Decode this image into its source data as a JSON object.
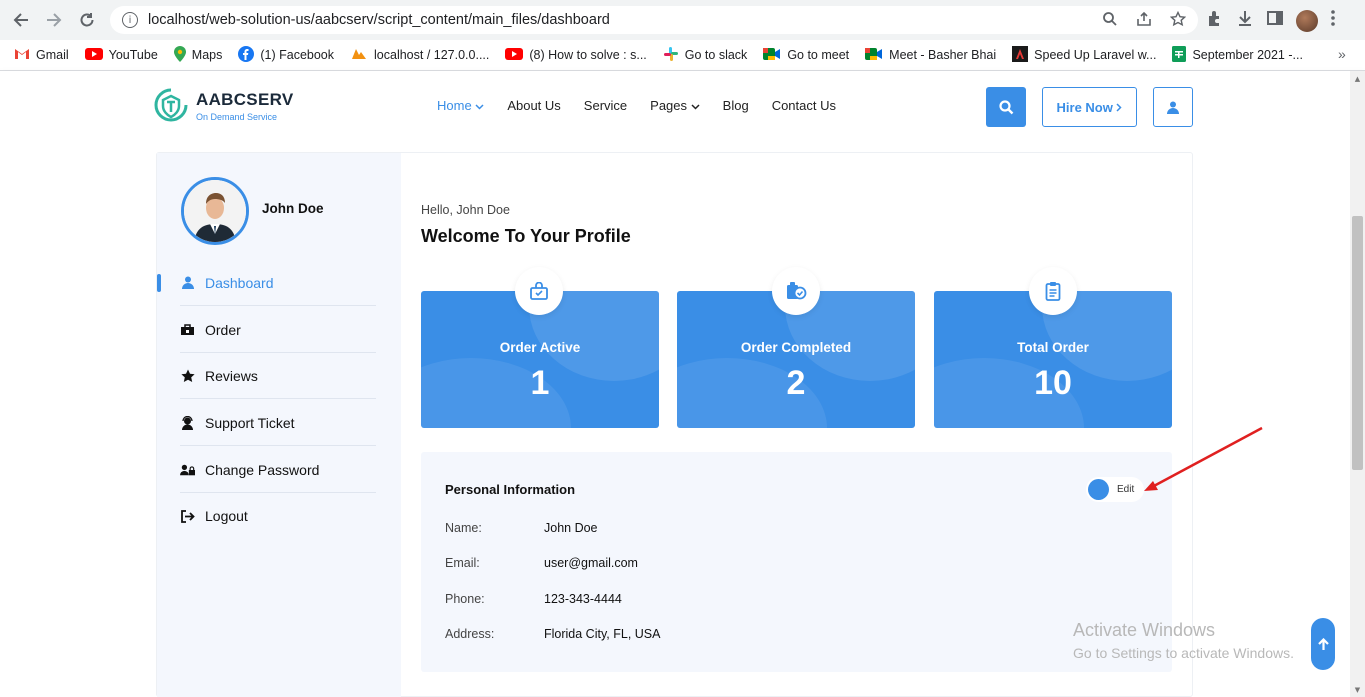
{
  "browser": {
    "url": "localhost/web-solution-us/aabcserv/script_content/main_files/dashboard",
    "bookmarks": [
      {
        "label": "Gmail",
        "color": "#ea4335"
      },
      {
        "label": "YouTube",
        "color": "#ff0000"
      },
      {
        "label": "Maps",
        "color": "#34a853"
      },
      {
        "label": "(1) Facebook",
        "color": "#1877f2"
      },
      {
        "label": "localhost / 127.0.0....",
        "color": "#f29111"
      },
      {
        "label": "(8) How to solve : s...",
        "color": "#ff0000"
      },
      {
        "label": "Go to slack",
        "color": "#e01e5a"
      },
      {
        "label": "Go to meet",
        "color": "#00832d"
      },
      {
        "label": "Meet - Basher Bhai",
        "color": "#00832d"
      },
      {
        "label": "Speed Up Laravel w...",
        "color": "#8b0000"
      },
      {
        "label": "September 2021 -...",
        "color": "#0f9d58"
      }
    ],
    "more": "»"
  },
  "site": {
    "logo_name": "AABCSERV",
    "logo_tag": "On Demand Service",
    "menu": {
      "home": "Home",
      "about": "About Us",
      "service": "Service",
      "pages": "Pages",
      "blog": "Blog",
      "contact": "Contact Us"
    },
    "hire_label": "Hire Now",
    "accent": "#3a8ee6"
  },
  "sidebar": {
    "user_name": "John Doe",
    "items": [
      {
        "label": "Dashboard",
        "icon": "user-icon"
      },
      {
        "label": "Order",
        "icon": "bag-icon"
      },
      {
        "label": "Reviews",
        "icon": "star-icon"
      },
      {
        "label": "Support Ticket",
        "icon": "support-icon"
      },
      {
        "label": "Change Password",
        "icon": "users-lock-icon"
      },
      {
        "label": "Logout",
        "icon": "logout-icon"
      }
    ]
  },
  "main": {
    "hello": "Hello, John Doe",
    "welcome": "Welcome To Your Profile",
    "stats": [
      {
        "label": "Order Active",
        "value": "1"
      },
      {
        "label": "Order Completed",
        "value": "2"
      },
      {
        "label": "Total Order",
        "value": "10"
      }
    ],
    "personal": {
      "title": "Personal Information",
      "edit_label": "Edit",
      "rows": [
        {
          "label": "Name:",
          "value": "John Doe"
        },
        {
          "label": "Email:",
          "value": "user@gmail.com"
        },
        {
          "label": "Phone:",
          "value": "123-343-4444"
        },
        {
          "label": "Address:",
          "value": "Florida City, FL, USA"
        }
      ]
    }
  },
  "overlay": {
    "activate_title": "Activate Windows",
    "activate_sub": "Go to Settings to activate Windows."
  }
}
